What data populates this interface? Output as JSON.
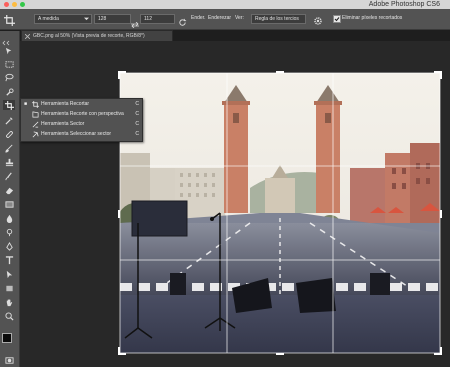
{
  "window": {
    "title": "Adobe Photoshop CS6"
  },
  "options_bar": {
    "ratio_select": "A medida",
    "width_value": "128",
    "height_value": "112",
    "straighten_label": "Ender.",
    "straighten_full": "Enderezar",
    "view_label": "Ver:",
    "view_select": "Regla de los tercios",
    "delete_cropped_label": "Eliminar píxeles recortados"
  },
  "document": {
    "tab_title": "GBC.png al 50% (Vista previa de recorte, RGB/8*)"
  },
  "crop_flyout": {
    "items": [
      {
        "label": "Herramienta Recortar",
        "key": "C"
      },
      {
        "label": "Herramienta Recorte con perspectiva",
        "key": "C"
      },
      {
        "label": "Herramienta Sector",
        "key": "C"
      },
      {
        "label": "Herramienta Seleccionar sector",
        "key": "C"
      }
    ]
  },
  "colors": {
    "ui_dark": "#535353",
    "canvas_bg": "#282828",
    "accent": "#2a6fd6"
  }
}
